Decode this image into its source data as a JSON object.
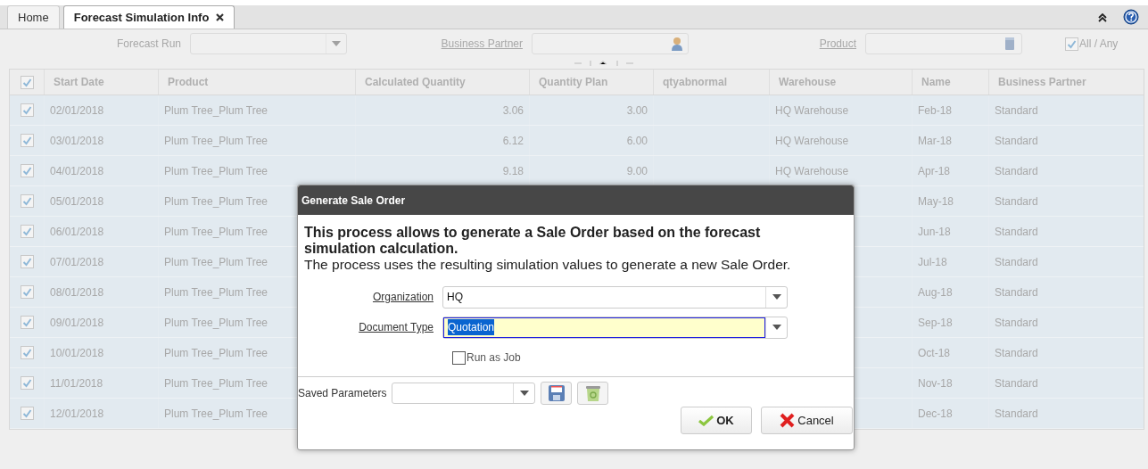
{
  "tabs": [
    {
      "label": "Home",
      "selected": false,
      "closable": false
    },
    {
      "label": "Forecast Simulation Info",
      "selected": true,
      "closable": true
    }
  ],
  "filters": {
    "forecast_run": {
      "label": "Forecast Run"
    },
    "business_partner": {
      "label": "Business Partner"
    },
    "product": {
      "label": "Product"
    },
    "all_any": {
      "label": "All / Any",
      "checked": true
    }
  },
  "table": {
    "select_all_checked": true,
    "columns": [
      "Start Date",
      "Product",
      "Calculated Quantity",
      "Quantity Plan",
      "qtyabnormal",
      "Warehouse",
      "Name",
      "Business Partner"
    ],
    "rows": [
      {
        "checked": true,
        "cells": [
          "02/01/2018",
          "Plum Tree_Plum Tree",
          "3.06",
          "3.00",
          "",
          "HQ Warehouse",
          "Feb-18",
          "Standard"
        ]
      },
      {
        "checked": true,
        "cells": [
          "03/01/2018",
          "Plum Tree_Plum Tree",
          "6.12",
          "6.00",
          "",
          "HQ Warehouse",
          "Mar-18",
          "Standard"
        ]
      },
      {
        "checked": true,
        "cells": [
          "04/01/2018",
          "Plum Tree_Plum Tree",
          "9.18",
          "9.00",
          "",
          "HQ Warehouse",
          "Apr-18",
          "Standard"
        ]
      },
      {
        "checked": true,
        "cells": [
          "05/01/2018",
          "Plum Tree_Plum Tree",
          "",
          "",
          "",
          "",
          "May-18",
          "Standard"
        ]
      },
      {
        "checked": true,
        "cells": [
          "06/01/2018",
          "Plum Tree_Plum Tree",
          "",
          "",
          "",
          "",
          "Jun-18",
          "Standard"
        ]
      },
      {
        "checked": true,
        "cells": [
          "07/01/2018",
          "Plum Tree_Plum Tree",
          "",
          "",
          "",
          "",
          "Jul-18",
          "Standard"
        ]
      },
      {
        "checked": true,
        "cells": [
          "08/01/2018",
          "Plum Tree_Plum Tree",
          "",
          "",
          "",
          "",
          "Aug-18",
          "Standard"
        ]
      },
      {
        "checked": true,
        "cells": [
          "09/01/2018",
          "Plum Tree_Plum Tree",
          "",
          "",
          "",
          "",
          "Sep-18",
          "Standard"
        ]
      },
      {
        "checked": true,
        "cells": [
          "10/01/2018",
          "Plum Tree_Plum Tree",
          "",
          "",
          "",
          "",
          "Oct-18",
          "Standard"
        ]
      },
      {
        "checked": true,
        "cells": [
          "11/01/2018",
          "Plum Tree_Plum Tree",
          "",
          "",
          "",
          "",
          "Nov-18",
          "Standard"
        ]
      },
      {
        "checked": true,
        "cells": [
          "12/01/2018",
          "Plum Tree_Plum Tree",
          "",
          "",
          "",
          "",
          "Dec-18",
          "Standard"
        ]
      }
    ]
  },
  "dialog": {
    "title": "Generate Sale Order",
    "heading": "This process allows to generate a Sale Order based on the forecast simulation calculation.",
    "description": "The process uses the resulting simulation values  to generate a new Sale Order.",
    "fields": [
      {
        "label": "Organization",
        "value": "HQ",
        "focused": false
      },
      {
        "label": "Document Type",
        "value": "Quotation",
        "focused": true
      }
    ],
    "run_as_job": {
      "label": "Run as Job",
      "checked": false
    },
    "saved_parameters": {
      "label": "Saved Parameters"
    },
    "buttons": [
      {
        "label": "OK",
        "kind": "ok"
      },
      {
        "label": "Cancel",
        "kind": "cancel"
      }
    ]
  }
}
